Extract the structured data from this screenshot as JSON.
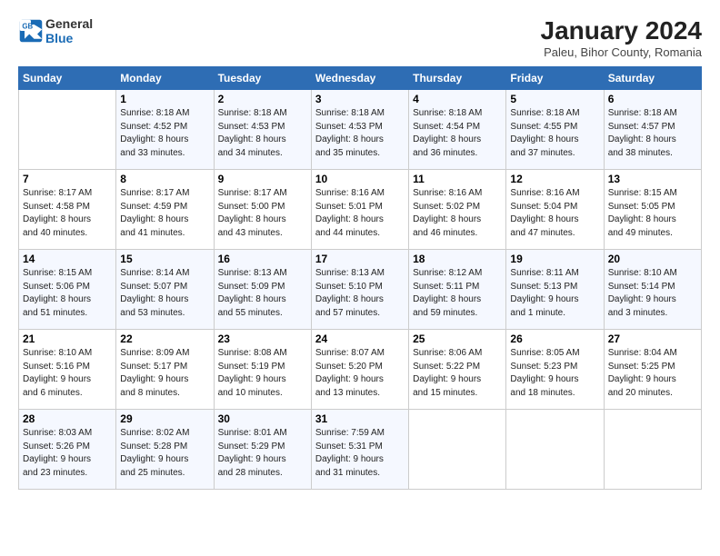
{
  "header": {
    "logo_general": "General",
    "logo_blue": "Blue",
    "title": "January 2024",
    "subtitle": "Paleu, Bihor County, Romania"
  },
  "days_of_week": [
    "Sunday",
    "Monday",
    "Tuesday",
    "Wednesday",
    "Thursday",
    "Friday",
    "Saturday"
  ],
  "weeks": [
    [
      {
        "day": "",
        "info": ""
      },
      {
        "day": "1",
        "info": "Sunrise: 8:18 AM\nSunset: 4:52 PM\nDaylight: 8 hours\nand 33 minutes."
      },
      {
        "day": "2",
        "info": "Sunrise: 8:18 AM\nSunset: 4:53 PM\nDaylight: 8 hours\nand 34 minutes."
      },
      {
        "day": "3",
        "info": "Sunrise: 8:18 AM\nSunset: 4:53 PM\nDaylight: 8 hours\nand 35 minutes."
      },
      {
        "day": "4",
        "info": "Sunrise: 8:18 AM\nSunset: 4:54 PM\nDaylight: 8 hours\nand 36 minutes."
      },
      {
        "day": "5",
        "info": "Sunrise: 8:18 AM\nSunset: 4:55 PM\nDaylight: 8 hours\nand 37 minutes."
      },
      {
        "day": "6",
        "info": "Sunrise: 8:18 AM\nSunset: 4:57 PM\nDaylight: 8 hours\nand 38 minutes."
      }
    ],
    [
      {
        "day": "7",
        "info": "Sunrise: 8:17 AM\nSunset: 4:58 PM\nDaylight: 8 hours\nand 40 minutes."
      },
      {
        "day": "8",
        "info": "Sunrise: 8:17 AM\nSunset: 4:59 PM\nDaylight: 8 hours\nand 41 minutes."
      },
      {
        "day": "9",
        "info": "Sunrise: 8:17 AM\nSunset: 5:00 PM\nDaylight: 8 hours\nand 43 minutes."
      },
      {
        "day": "10",
        "info": "Sunrise: 8:16 AM\nSunset: 5:01 PM\nDaylight: 8 hours\nand 44 minutes."
      },
      {
        "day": "11",
        "info": "Sunrise: 8:16 AM\nSunset: 5:02 PM\nDaylight: 8 hours\nand 46 minutes."
      },
      {
        "day": "12",
        "info": "Sunrise: 8:16 AM\nSunset: 5:04 PM\nDaylight: 8 hours\nand 47 minutes."
      },
      {
        "day": "13",
        "info": "Sunrise: 8:15 AM\nSunset: 5:05 PM\nDaylight: 8 hours\nand 49 minutes."
      }
    ],
    [
      {
        "day": "14",
        "info": "Sunrise: 8:15 AM\nSunset: 5:06 PM\nDaylight: 8 hours\nand 51 minutes."
      },
      {
        "day": "15",
        "info": "Sunrise: 8:14 AM\nSunset: 5:07 PM\nDaylight: 8 hours\nand 53 minutes."
      },
      {
        "day": "16",
        "info": "Sunrise: 8:13 AM\nSunset: 5:09 PM\nDaylight: 8 hours\nand 55 minutes."
      },
      {
        "day": "17",
        "info": "Sunrise: 8:13 AM\nSunset: 5:10 PM\nDaylight: 8 hours\nand 57 minutes."
      },
      {
        "day": "18",
        "info": "Sunrise: 8:12 AM\nSunset: 5:11 PM\nDaylight: 8 hours\nand 59 minutes."
      },
      {
        "day": "19",
        "info": "Sunrise: 8:11 AM\nSunset: 5:13 PM\nDaylight: 9 hours\nand 1 minute."
      },
      {
        "day": "20",
        "info": "Sunrise: 8:10 AM\nSunset: 5:14 PM\nDaylight: 9 hours\nand 3 minutes."
      }
    ],
    [
      {
        "day": "21",
        "info": "Sunrise: 8:10 AM\nSunset: 5:16 PM\nDaylight: 9 hours\nand 6 minutes."
      },
      {
        "day": "22",
        "info": "Sunrise: 8:09 AM\nSunset: 5:17 PM\nDaylight: 9 hours\nand 8 minutes."
      },
      {
        "day": "23",
        "info": "Sunrise: 8:08 AM\nSunset: 5:19 PM\nDaylight: 9 hours\nand 10 minutes."
      },
      {
        "day": "24",
        "info": "Sunrise: 8:07 AM\nSunset: 5:20 PM\nDaylight: 9 hours\nand 13 minutes."
      },
      {
        "day": "25",
        "info": "Sunrise: 8:06 AM\nSunset: 5:22 PM\nDaylight: 9 hours\nand 15 minutes."
      },
      {
        "day": "26",
        "info": "Sunrise: 8:05 AM\nSunset: 5:23 PM\nDaylight: 9 hours\nand 18 minutes."
      },
      {
        "day": "27",
        "info": "Sunrise: 8:04 AM\nSunset: 5:25 PM\nDaylight: 9 hours\nand 20 minutes."
      }
    ],
    [
      {
        "day": "28",
        "info": "Sunrise: 8:03 AM\nSunset: 5:26 PM\nDaylight: 9 hours\nand 23 minutes."
      },
      {
        "day": "29",
        "info": "Sunrise: 8:02 AM\nSunset: 5:28 PM\nDaylight: 9 hours\nand 25 minutes."
      },
      {
        "day": "30",
        "info": "Sunrise: 8:01 AM\nSunset: 5:29 PM\nDaylight: 9 hours\nand 28 minutes."
      },
      {
        "day": "31",
        "info": "Sunrise: 7:59 AM\nSunset: 5:31 PM\nDaylight: 9 hours\nand 31 minutes."
      },
      {
        "day": "",
        "info": ""
      },
      {
        "day": "",
        "info": ""
      },
      {
        "day": "",
        "info": ""
      }
    ]
  ]
}
